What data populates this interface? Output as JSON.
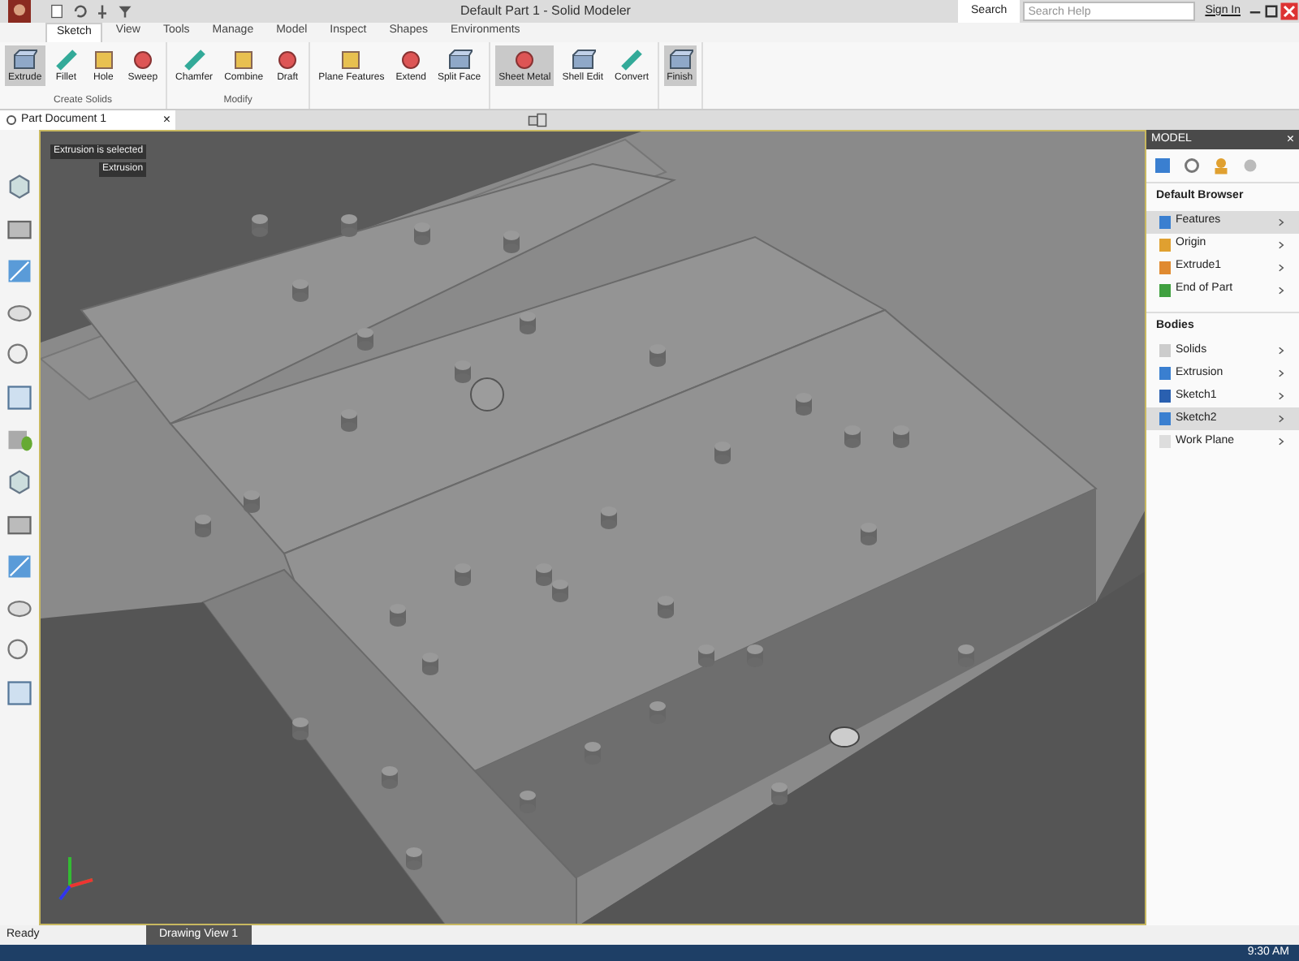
{
  "title_bar": {
    "title": "Default Part 1 - Solid Modeler",
    "search_tab": "Search",
    "search_placeholder": "Search Help",
    "sign_in": "Sign In"
  },
  "ribbon_tabs": [
    {
      "label": "Sketch",
      "selected": true
    },
    {
      "label": "View",
      "selected": false
    },
    {
      "label": "Tools",
      "selected": false
    },
    {
      "label": "Manage",
      "selected": false
    },
    {
      "label": "Model",
      "selected": false
    },
    {
      "label": "Inspect",
      "selected": false
    },
    {
      "label": "Shapes",
      "selected": false
    },
    {
      "label": "Environments",
      "selected": false
    }
  ],
  "ribbon_groups": [
    {
      "label": "Create Solids",
      "items": [
        {
          "label": "Extrude",
          "selected": true
        },
        {
          "label": "Fillet",
          "selected": false
        },
        {
          "label": "Hole",
          "selected": false
        },
        {
          "label": "Sweep",
          "selected": false
        }
      ]
    },
    {
      "label": "Modify",
      "items": [
        {
          "label": "Chamfer",
          "selected": false
        },
        {
          "label": "Combine",
          "selected": false
        },
        {
          "label": "Draft",
          "selected": false
        }
      ]
    },
    {
      "items": [
        {
          "label": "Plane Features",
          "selected": false
        },
        {
          "label": "Extend",
          "selected": false
        },
        {
          "label": "Split Face",
          "selected": false
        }
      ]
    },
    {
      "items": [
        {
          "label": "Sheet Metal",
          "selected": true
        },
        {
          "label": "Shell Edit",
          "selected": false
        },
        {
          "label": "Convert",
          "selected": false
        }
      ]
    },
    {
      "items": [
        {
          "label": "Finish",
          "selected": true
        }
      ]
    }
  ],
  "document_tab": {
    "label": "Part Document 1",
    "close": "×"
  },
  "viewport": {
    "overlay": [
      "Extrusion is selected",
      "Extrusion"
    ]
  },
  "browser": {
    "title": "MODEL",
    "close": "×",
    "header": "Default Browser",
    "items": [
      {
        "label": "Features",
        "selected": true,
        "color": "#3a7fd0"
      },
      {
        "label": "Origin",
        "selected": false,
        "color": "#e0a030"
      },
      {
        "label": "Extrude1",
        "selected": false,
        "color": "#e08a30"
      },
      {
        "label": "End of Part",
        "selected": false,
        "color": "#40a040"
      }
    ],
    "section": "Bodies",
    "bodies": [
      {
        "label": "Solids",
        "selected": false,
        "color": "#cccccc"
      },
      {
        "label": "Extrusion",
        "selected": false,
        "color": "#3a7fd0"
      },
      {
        "label": "Sketch1",
        "selected": false,
        "color": "#2a60b0"
      },
      {
        "label": "Sketch2",
        "selected": true,
        "color": "#3a7fd0"
      },
      {
        "label": "Work Plane",
        "selected": false,
        "color": "#dddddd"
      }
    ]
  },
  "status_bar": {
    "status": "Ready",
    "tab": "Drawing View 1",
    "time": "9:30 AM"
  }
}
